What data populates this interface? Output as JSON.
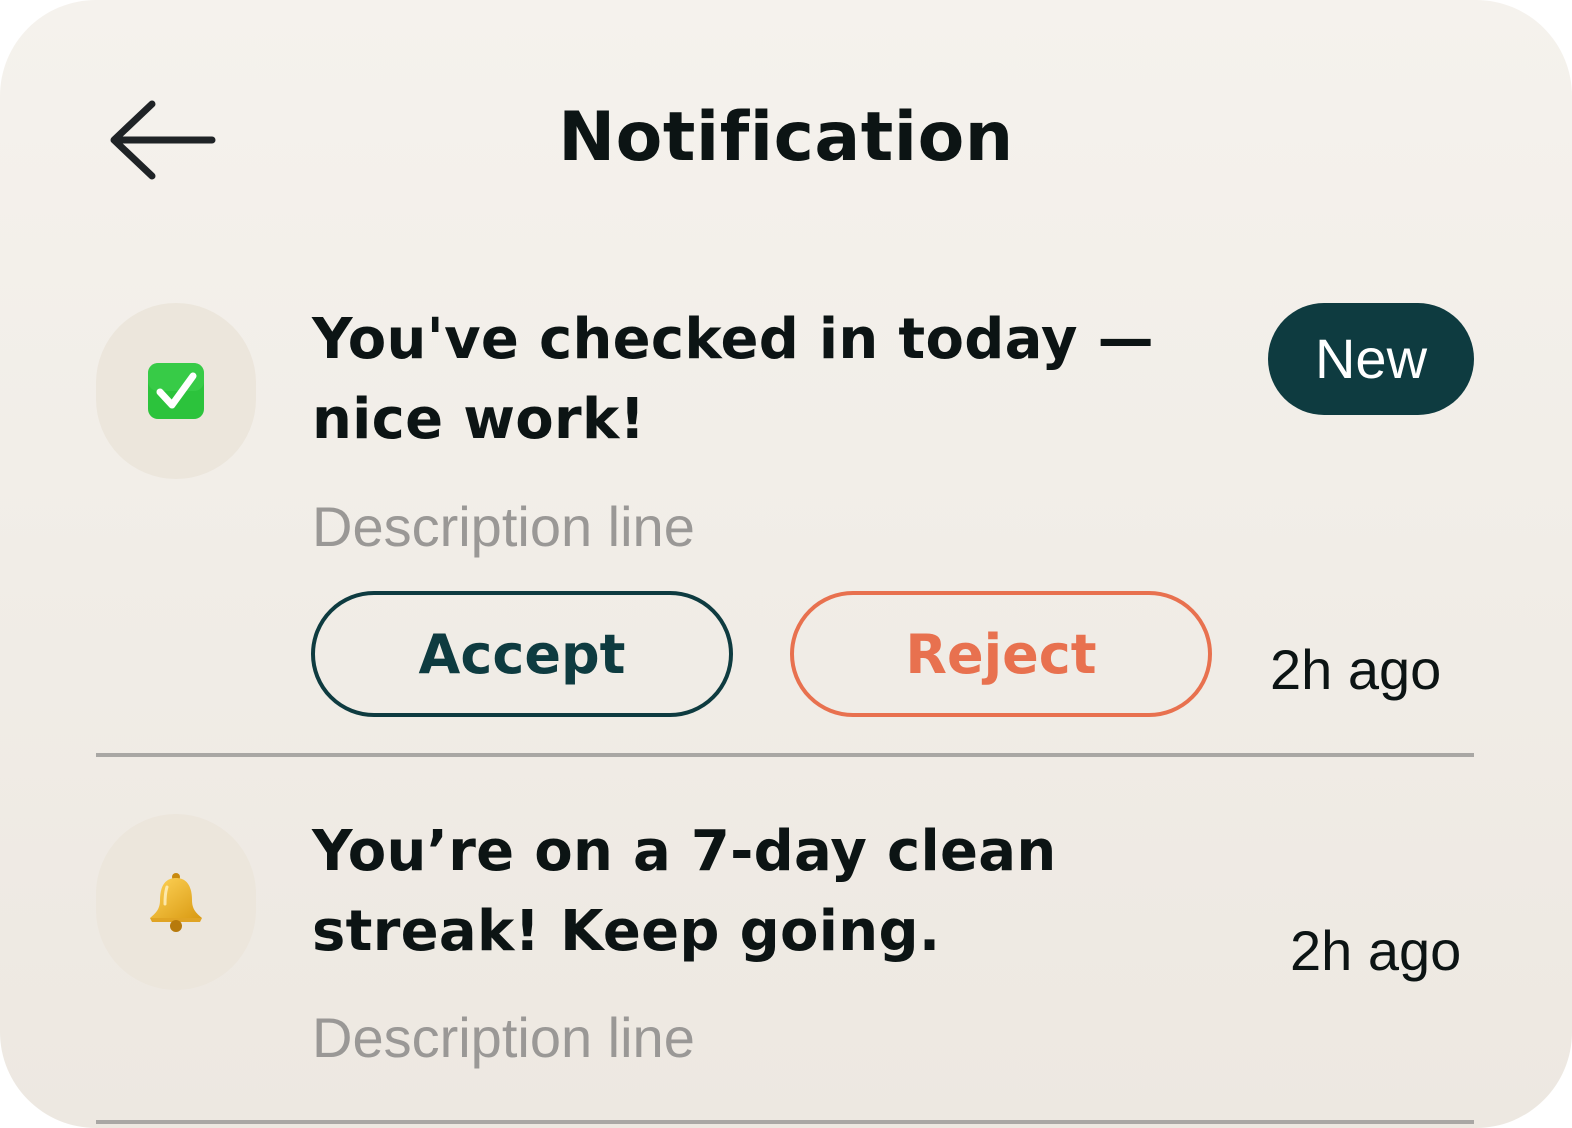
{
  "header": {
    "title": "Notification"
  },
  "notifications": [
    {
      "icon": "check-mark-button-icon",
      "title_line1": "You've checked in today —",
      "title_line2": "nice work!",
      "description": "Description line",
      "badge": "New",
      "time": "2h ago",
      "actions": {
        "accept": "Accept",
        "reject": "Reject"
      }
    },
    {
      "icon": "bell-icon",
      "title_line1": "You’re on a 7-day clean",
      "title_line2": "streak! Keep going.",
      "description": "Description line",
      "time": "2h ago"
    }
  ],
  "colors": {
    "background": "#f2eee8",
    "primary": "#0e3b40",
    "reject": "#e8714f",
    "muted_text": "#9a9896",
    "text": "#0c1414",
    "icon_bubble": "#ece6dc"
  }
}
